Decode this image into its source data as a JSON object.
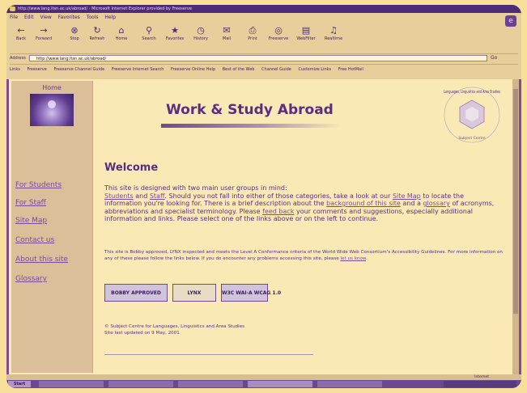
{
  "window": {
    "title": "http://www.lang.ltsn.ac.uk/abroad/ - Microsoft Internet Explorer provided by Freeserve"
  },
  "menubar": [
    "File",
    "Edit",
    "View",
    "Favorites",
    "Tools",
    "Help"
  ],
  "toolbar": [
    {
      "label": "Back",
      "icon": "←"
    },
    {
      "label": "Forward",
      "icon": "→"
    },
    {
      "label": "Stop",
      "icon": "⊗"
    },
    {
      "label": "Refresh",
      "icon": "↻"
    },
    {
      "label": "Home",
      "icon": "⌂"
    },
    {
      "label": "Search",
      "icon": "⚲"
    },
    {
      "label": "Favorites",
      "icon": "★"
    },
    {
      "label": "History",
      "icon": "◷"
    },
    {
      "label": "Mail",
      "icon": "✉"
    },
    {
      "label": "Print",
      "icon": "⎙"
    },
    {
      "label": "Freeserve",
      "icon": "◎"
    },
    {
      "label": "WebFilter",
      "icon": "▤"
    },
    {
      "label": "Realtime",
      "icon": "♫"
    }
  ],
  "address": {
    "label": "Address",
    "value": "http://www.lang.ltsn.ac.uk/abroad/",
    "go_label": "Go"
  },
  "links": [
    "Freeserve",
    "Freeserve Channel Guide",
    "Freeserve Internet Search",
    "Freeserve Online Help",
    "Best of the Web",
    "Channel Guide",
    "Customize Links",
    "Free HotMail"
  ],
  "nav": {
    "home": "Home",
    "items": [
      "For Students",
      "For Staff",
      "Site Map",
      "Contact us",
      "About this site",
      "Glossary"
    ]
  },
  "page": {
    "title": "Work & Study Abroad",
    "logo_text": "Languages, Linguistics and Area Studies",
    "logo_subtext": "Subject Centre",
    "welcome_heading": "Welcome",
    "intro": {
      "p1": "This site is designed with two main user groups in mind:",
      "students_link": "Students",
      "and": "and",
      "staff_link": "Staff",
      "p2": ". Should you not fall into either of those categories, take a look at our",
      "sitemap_link": "Site Map",
      "p3": "to locate the information you're looking for. There is a brief description about the",
      "background_link": "background of this site",
      "p4": "and a",
      "glossary_link": "glossary",
      "p5": "of acronyms, abbreviations and specialist terminology. Please",
      "feedback_link": "feed back",
      "p6": "your comments and suggestions, especially additional information and links. Please select one of the links above or on the left to continue."
    },
    "accessibility": {
      "text": "This site is Bobby approved, LYNX inspected and meets the Level A Conformance criteria of the World Wide Web Consortium's Accessibility Guidelines. For more information on any of these please follow the links below. If you do encounter any problems accessing this site, please",
      "link": "let us know",
      "end": "."
    },
    "badges": [
      "BOBBY APPROVED",
      "LYNX",
      "W3C WAI-A WCAG 1.0"
    ],
    "copyright": "© Subject Centre for Languages, Linguistics and Area Studies",
    "updated": "Site last updated on 9 May, 2001"
  },
  "status": {
    "zone": "Internet"
  },
  "taskbar": {
    "start_label": "Start"
  },
  "colors": {
    "accent": "#5a2c82",
    "link": "#7a4a9a",
    "page_bg": "#fbe9b5"
  }
}
